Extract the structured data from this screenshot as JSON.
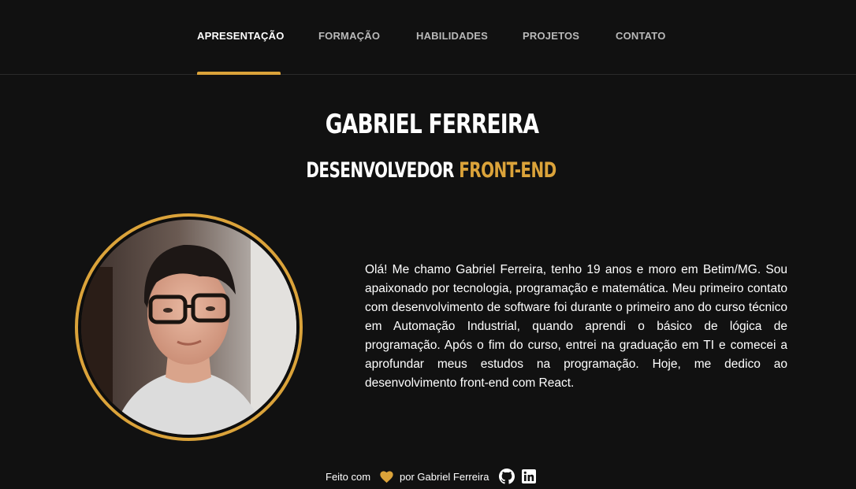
{
  "nav": {
    "items": [
      {
        "label": "APRESENTAÇÃO",
        "active": true
      },
      {
        "label": "FORMAÇÃO",
        "active": false
      },
      {
        "label": "HABILIDADES",
        "active": false
      },
      {
        "label": "PROJETOS",
        "active": false
      },
      {
        "label": "CONTATO",
        "active": false
      }
    ]
  },
  "hero": {
    "name": "GABRIEL FERREIRA",
    "role_prefix": "DESENVOLVEDOR",
    "role_accent": "FRONT-END"
  },
  "bio": "Olá! Me chamo Gabriel Ferreira, tenho 19 anos e moro em Betim/MG. Sou apaixonado por tecnologia, programação e matemática. Meu primeiro contato com desenvolvimento de software foi durante o primeiro ano do curso técnico em Automação Industrial, quando aprendi o básico de lógica de programação. Após o fim do curso, entrei na graduação em TI e comecei a aprofundar meus estudos na programação. Hoje, me dedico ao desenvolvimento front-end com React.",
  "footer": {
    "made_with": "Feito com",
    "by": "por Gabriel Ferreira",
    "icons": [
      "heart-icon",
      "github-icon",
      "linkedin-icon"
    ]
  },
  "colors": {
    "background": "#111111",
    "accent": "#dba33a",
    "nav_inactive": "#b9b9b9",
    "text": "#ffffff"
  }
}
